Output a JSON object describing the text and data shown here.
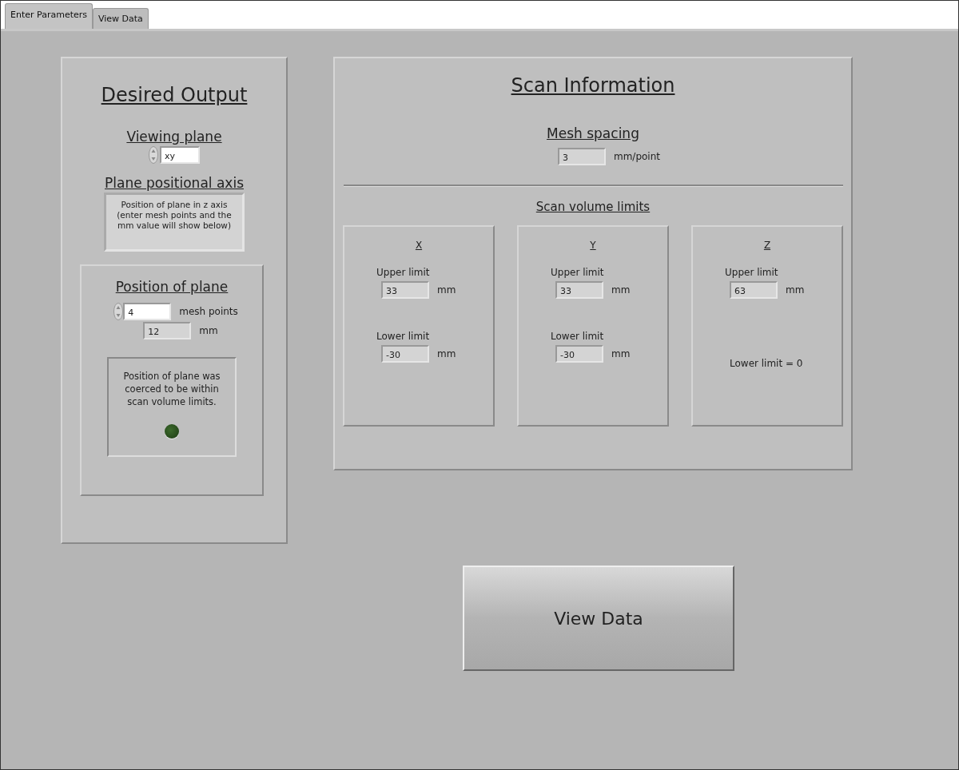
{
  "tabs": [
    {
      "label": "Enter Parameters",
      "selected": true
    },
    {
      "label": "View Data",
      "selected": false
    }
  ],
  "desired_output": {
    "title": "Desired Output",
    "viewing_plane": {
      "label": "Viewing plane",
      "value": "xy"
    },
    "plane_axis": {
      "label": "Plane positional axis",
      "text": "Position of plane in z axis\n(enter mesh points and the\nmm value will show below)"
    },
    "position": {
      "title": "Position of plane",
      "mesh_points": "4",
      "mesh_unit": "mesh points",
      "mm": "12",
      "mm_unit": "mm",
      "message": "Position of plane was\ncoerced to be within\nscan volume limits.",
      "indicator_on": false
    }
  },
  "scan_information": {
    "title": "Scan Information",
    "mesh_spacing": {
      "label": "Mesh spacing",
      "value": "3",
      "unit": "mm/point"
    },
    "limits_title": "Scan volume limits",
    "axes": [
      {
        "label": "X",
        "kind": "range",
        "upper_label": "Upper limit",
        "upper": "33",
        "upper_unit": "mm",
        "lower_label": "Lower limit",
        "lower": "-30",
        "lower_unit": "mm"
      },
      {
        "label": "Y",
        "kind": "range",
        "upper_label": "Upper limit",
        "upper": "33",
        "upper_unit": "mm",
        "lower_label": "Lower limit",
        "lower": "-30",
        "lower_unit": "mm"
      },
      {
        "label": "Z",
        "kind": "fixed",
        "upper_label": "Upper limit",
        "upper": "63",
        "upper_unit": "mm",
        "lower_text": "Lower limit = 0"
      }
    ]
  },
  "view_button": "View Data"
}
